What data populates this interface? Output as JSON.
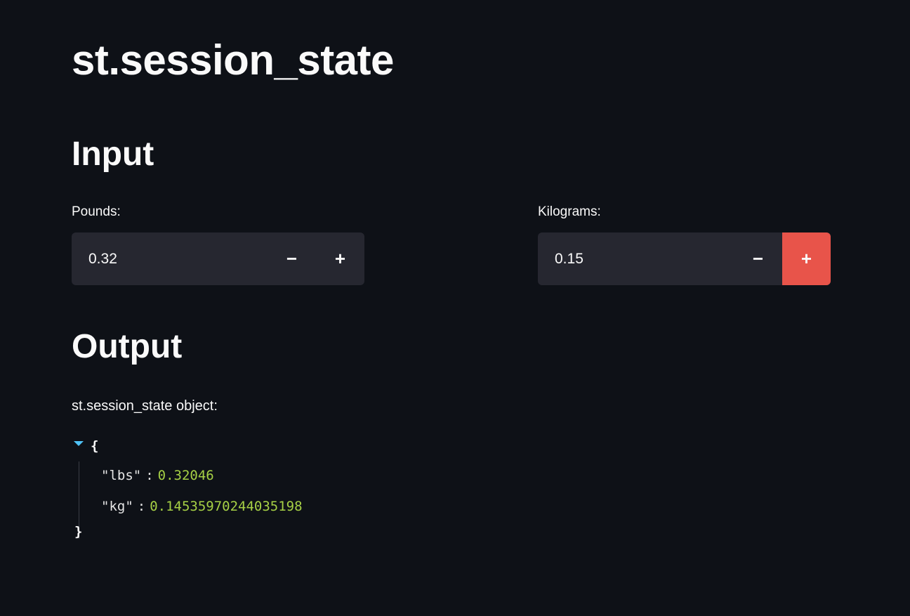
{
  "page": {
    "title": "st.session_state"
  },
  "input_section": {
    "heading": "Input",
    "pounds": {
      "label": "Pounds:",
      "value": "0.32",
      "minus": "−",
      "plus": "+"
    },
    "kilograms": {
      "label": "Kilograms:",
      "value": "0.15",
      "minus": "−",
      "plus": "+"
    }
  },
  "output_section": {
    "heading": "Output",
    "object_label": "st.session_state object:",
    "json": {
      "open": "{",
      "close": "}",
      "colon": ":",
      "entries": [
        {
          "key": "\"lbs\"",
          "value": "0.32046"
        },
        {
          "key": "\"kg\"",
          "value": "0.14535970244035198"
        }
      ]
    }
  },
  "colors": {
    "background": "#0e1117",
    "input_bg": "#262730",
    "accent": "#e8544a",
    "json_number": "#a6d045",
    "caret": "#4fc3f7"
  },
  "icons": {
    "collapse": "caret-down-icon"
  }
}
